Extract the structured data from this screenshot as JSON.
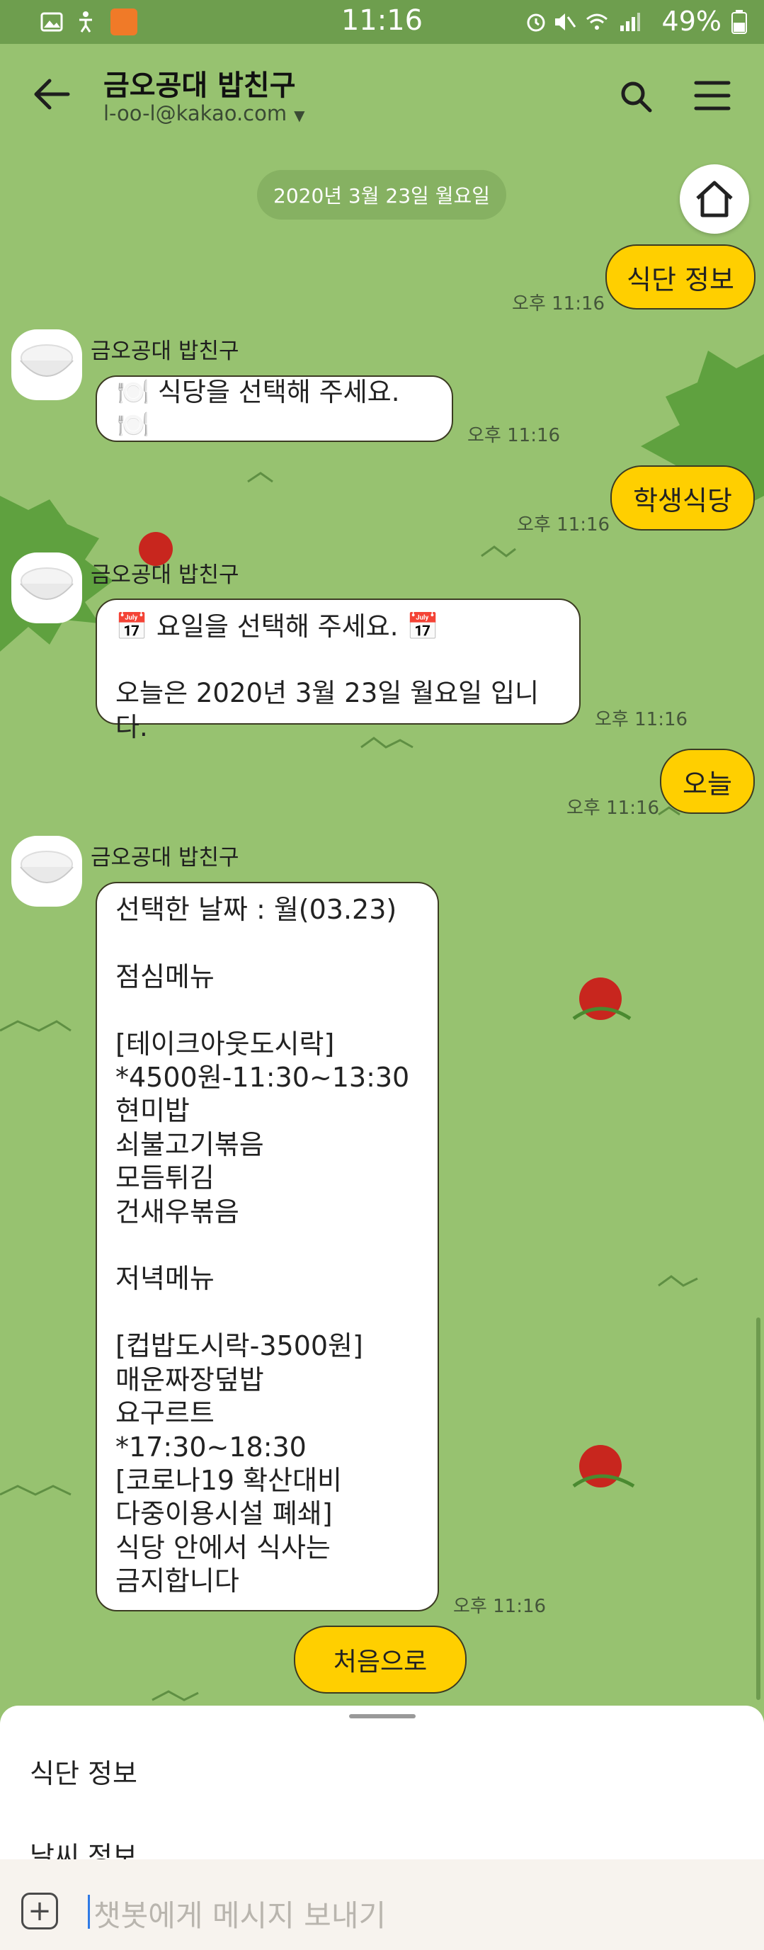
{
  "status_bar": {
    "time": "11:16",
    "battery": "49%"
  },
  "header": {
    "title": "금오공대 밥친구",
    "subtitle": "l-oo-l@kakao.com"
  },
  "date_divider": "2020년 3월 23일 월요일",
  "bot": {
    "name": "금오공대 밥친구"
  },
  "messages": {
    "m1": {
      "text": "식단 정보",
      "time": "오후 11:16"
    },
    "m2": {
      "text": "🍽️ 식당을 선택해 주세요. 🍽️",
      "time": "오후 11:16"
    },
    "m3": {
      "text": "학생식당",
      "time": "오후 11:16"
    },
    "m4": {
      "line1": "📅 요일을 선택해 주세요. 📅",
      "line2": "오늘은 2020년 3월 23일 월요일 입니다.",
      "time": "오후 11:16"
    },
    "m5": {
      "text": "오늘",
      "time": "오후 11:16"
    },
    "m6": {
      "text": "선택한 날짜 : 월(03.23)\n\n점심메뉴\n\n[테이크아웃도시락]\n*4500원-11:30~13:30\n현미밥\n쇠불고기볶음\n모듬튀김\n건새우볶음\n\n저녁메뉴\n\n[컵밥도시락-3500원]\n매운짜장덮밥\n요구르트\n*17:30~18:30\n[코로나19 확산대비\n다중이용시설 폐쇄]\n식당 안에서 식사는\n금지합니다",
      "time": "오후 11:16"
    }
  },
  "quick_reply": "처음으로",
  "bottom_sheet": {
    "items": [
      "식단 정보",
      "날씨 정보"
    ]
  },
  "input": {
    "placeholder": "챗봇에게 메시지 보내기"
  },
  "colors": {
    "background": "#97c270",
    "bubble_user": "#ffcf00",
    "bubble_bot": "#ffffff"
  }
}
